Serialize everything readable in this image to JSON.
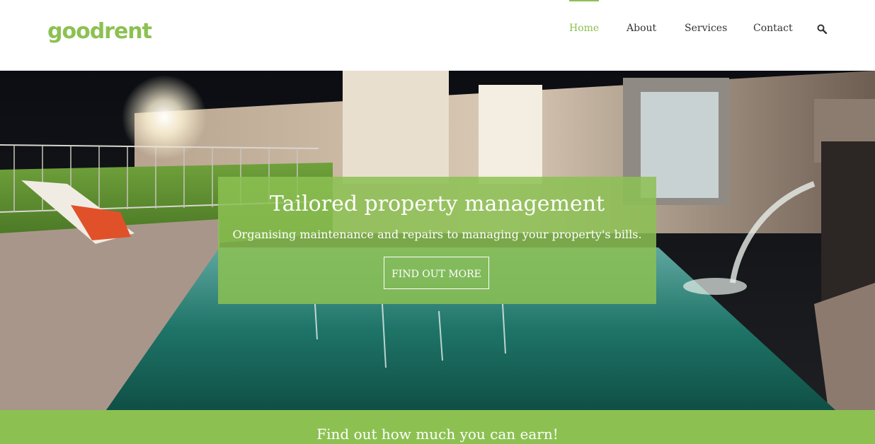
{
  "header": {
    "logo": "goodrent",
    "nav": [
      {
        "label": "Home",
        "active": true
      },
      {
        "label": "About",
        "active": false
      },
      {
        "label": "Services",
        "active": false
      },
      {
        "label": "Contact",
        "active": false
      }
    ],
    "search_icon": "search-icon"
  },
  "hero": {
    "title": "Tailored property management",
    "subtitle": "Organising maintenance and repairs to managing your property's bills.",
    "cta_label": "FIND OUT MORE"
  },
  "band": {
    "title": "Find out how much you can earn!"
  },
  "colors": {
    "brand_green": "#8cc152",
    "nav_text": "#333333"
  }
}
